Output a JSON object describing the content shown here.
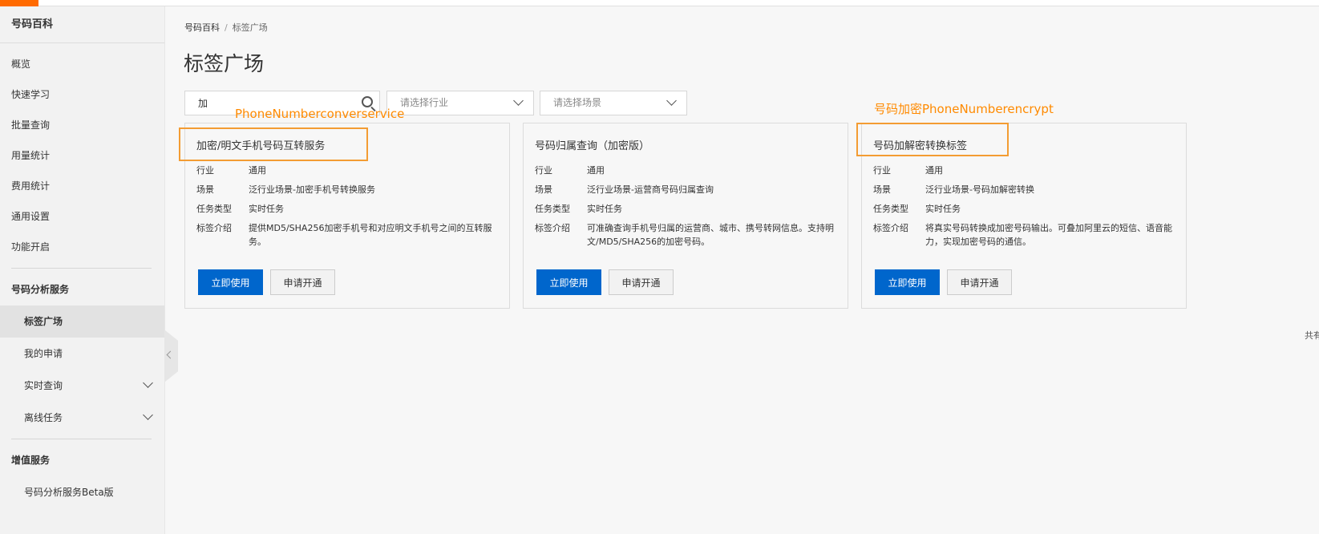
{
  "colors": {
    "accent": "#ff6a00",
    "primary": "#0066cc",
    "annotation": "#f39c33"
  },
  "sidebar": {
    "title": "号码百科",
    "top_items": [
      "概览",
      "快速学习",
      "批量查询",
      "用量统计",
      "费用统计",
      "通用设置",
      "功能开启"
    ],
    "section1": "号码分析服务",
    "sub_items": [
      {
        "label": "标签广场",
        "active": true
      },
      {
        "label": "我的申请"
      },
      {
        "label": "实时查询",
        "expandable": true
      },
      {
        "label": "离线任务",
        "expandable": true
      }
    ],
    "section2": "增值服务",
    "value_items": [
      "号码分析服务Beta版"
    ]
  },
  "breadcrumb": {
    "root": "号码百科",
    "separator": "/",
    "current": "标签广场"
  },
  "page_title": "标签广场",
  "filters": {
    "search_value": "加",
    "industry_placeholder": "请选择行业",
    "scene_placeholder": "请选择场景"
  },
  "row_labels": {
    "industry": "行业",
    "scene": "场景",
    "task_type": "任务类型",
    "intro": "标签介绍"
  },
  "cards": [
    {
      "title": "加密/明文手机号码互转服务",
      "industry": "通用",
      "scene": "泛行业场景-加密手机号转换服务",
      "task_type": "实时任务",
      "intro": "提供MD5/SHA256加密手机号和对应明文手机号之间的互转服务。",
      "use_label": "立即使用",
      "apply_label": "申请开通"
    },
    {
      "title": "号码归属查询（加密版）",
      "industry": "通用",
      "scene": "泛行业场景-运营商号码归属查询",
      "task_type": "实时任务",
      "intro": "可准确查询手机号归属的运营商、城市、携号转网信息。支持明文/MD5/SHA256的加密号码。",
      "use_label": "立即使用",
      "apply_label": "申请开通"
    },
    {
      "title": "号码加解密转换标签",
      "industry": "通用",
      "scene": "泛行业场景-号码加解密转换",
      "task_type": "实时任务",
      "intro": "将真实号码转换成加密号码输出。可叠加阿里云的短信、语音能力，实现加密号码的通信。",
      "use_label": "立即使用",
      "apply_label": "申请开通"
    }
  ],
  "annotations": {
    "card1": "PhoneNumberconverservice",
    "card3": "号码加密PhoneNumberencrypt"
  },
  "pagination_total": "共有"
}
